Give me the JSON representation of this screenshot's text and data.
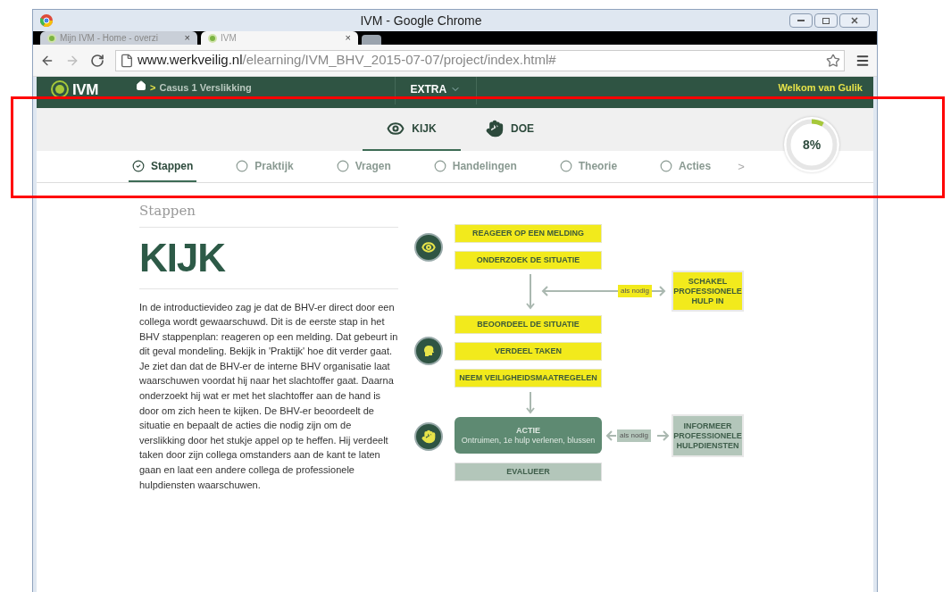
{
  "window": {
    "title": "IVM - Google Chrome"
  },
  "browser_tabs": [
    {
      "label": "Mijn IVM - Home - overzi",
      "close": "×",
      "selected": false
    },
    {
      "label": "IVM",
      "close": "×",
      "selected": true
    }
  ],
  "address_bar": {
    "domain": "www.werkveilig.nl",
    "path": "/elearning/IVM_BHV_2015-07-07/project/index.html#"
  },
  "site_header": {
    "logo": "IVM",
    "breadcrumb_separator": ">",
    "breadcrumb": "Casus 1 Verslikking",
    "menu": "EXTRA",
    "welcome": "Welkom van Gulik"
  },
  "mode_tabs": [
    {
      "label": "KIJK",
      "kind": "eye",
      "selected": true
    },
    {
      "label": "DOE",
      "kind": "hand",
      "selected": false
    }
  ],
  "progress": {
    "label": "8%",
    "level": 0.08
  },
  "step_tabs": [
    {
      "label": "Stappen",
      "selected": true
    },
    {
      "label": "Praktijk",
      "selected": false
    },
    {
      "label": "Vragen",
      "selected": false
    },
    {
      "label": "Handelingen",
      "selected": false
    },
    {
      "label": "Theorie",
      "selected": false
    },
    {
      "label": "Acties",
      "selected": false
    }
  ],
  "step_tabs_more": ">",
  "content": {
    "section": "Stappen",
    "heading": "KIJK",
    "body": "In de introductievideo zag je dat de BHV-er direct door een collega wordt gewaarschuwd. Dit is de eerste stap in het BHV stappenplan: reageren op een melding. Dat gebeurt in dit geval mondeling. Bekijk in 'Praktijk' hoe dit verder gaat. Je ziet dan dat de BHV-er de interne BHV organisatie laat waarschuwen voordat hij naar het slachtoffer gaat. Daarna onderzoekt hij wat er met het slachtoffer aan de hand is door om zich heen te kijken. De BHV-er beoordeelt de situatie en bepaalt de acties die nodig zijn om de verslikking door het stukje appel op te heffen. Hij verdeelt taken door zijn collega omstanders aan de kant te laten gaan en laat een andere collega de professionele hulpdiensten waarschuwen."
  },
  "flowchart": {
    "nodes": [
      {
        "kind": "step",
        "text": "REAGEER OP EEN MELDING"
      },
      {
        "kind": "step",
        "text": "ONDERZOEK DE SITUATIE"
      },
      {
        "kind": "external",
        "text": "SCHAKEL PROFESSIONELE HULP IN"
      },
      {
        "kind": "step",
        "text": "BEOORDEEL DE SITUATIE"
      },
      {
        "kind": "step",
        "text": "VERDEEL TAKEN"
      },
      {
        "kind": "step",
        "text": "NEEM VEILIGHEIDSMAATREGELEN"
      },
      {
        "kind": "action",
        "text": "ACTIE",
        "subtitle": "Ontruimen, 1e hulp verlenen, blussen"
      },
      {
        "kind": "external_grey",
        "text": "INFORMEER PROFESSIONELE HULPDIENSTEN"
      },
      {
        "kind": "evaluate",
        "text": "EVALUEER"
      }
    ],
    "connector_labels": [
      "als nodig",
      "als nodig"
    ]
  }
}
